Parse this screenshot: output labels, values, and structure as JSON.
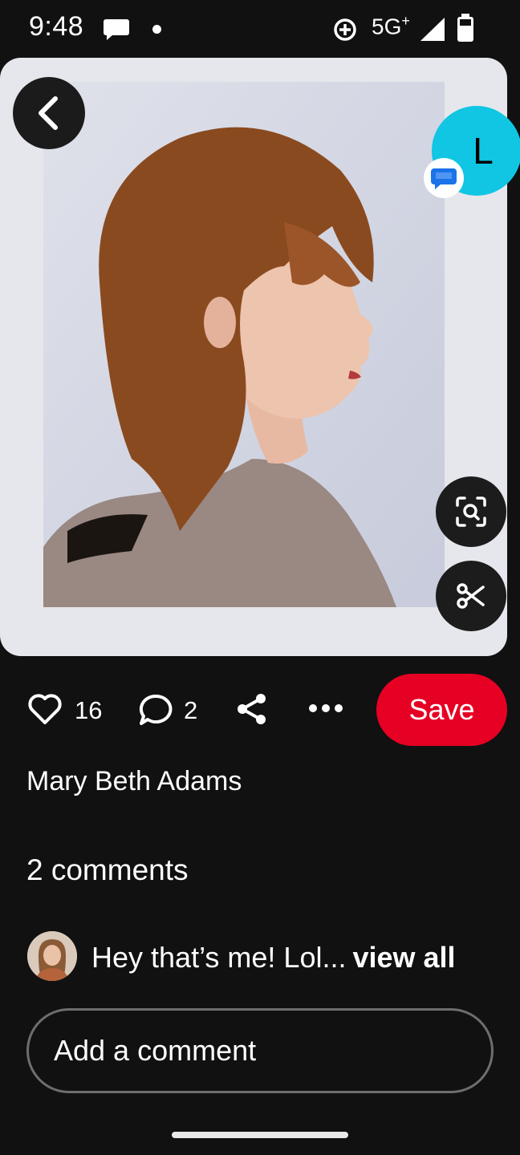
{
  "status_bar": {
    "time": "9:48",
    "network": "5G",
    "network_plus": "+",
    "icons": [
      "messages-icon",
      "notification-dot",
      "data-saver-icon",
      "signal-icon",
      "battery-icon"
    ]
  },
  "pin": {
    "image": {
      "description_icon": "hairstyle-photo",
      "colors": {
        "background": "#e6e7ec",
        "frame": "#d3d6e2",
        "hair": "#8a4a1f",
        "sweater": "#9a8882"
      }
    },
    "avatar_initial": "L",
    "avatar_color": "#10c6e3",
    "likes": "16",
    "comments_count": "2",
    "save_label": "Save",
    "save_color": "#e60023",
    "author": "Mary Beth Adams"
  },
  "comments": {
    "heading": "2 comments",
    "preview_text": "Hey that’s me! Lol...",
    "view_all_label": "view all",
    "input_placeholder": "Add a comment"
  }
}
